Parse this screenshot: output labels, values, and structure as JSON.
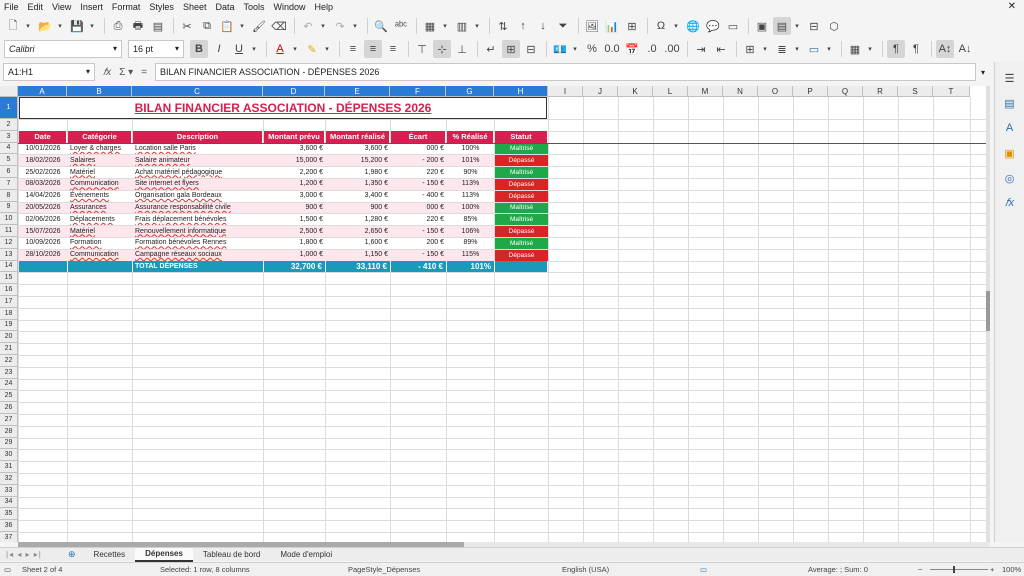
{
  "menu": [
    "File",
    "Edit",
    "View",
    "Insert",
    "Format",
    "Styles",
    "Sheet",
    "Data",
    "Tools",
    "Window",
    "Help"
  ],
  "font": {
    "name": "Calibri",
    "size": "16 pt"
  },
  "formula": {
    "namebox": "A1:H1",
    "content": "BILAN FINANCIER ASSOCIATION - DÉPENSES 2026"
  },
  "columns": [
    "A",
    "B",
    "C",
    "D",
    "E",
    "F",
    "G",
    "H",
    "I",
    "J",
    "K",
    "L",
    "M",
    "N",
    "O",
    "P",
    "Q",
    "R",
    "S",
    "T"
  ],
  "title": "BILAN FINANCIER ASSOCIATION - DÉPENSES 2026",
  "headers": [
    "Date",
    "Catégorie",
    "Description",
    "Montant prévu",
    "Montant réalisé",
    "Écart",
    "% Réalisé",
    "Statut"
  ],
  "rows": [
    {
      "date": "10/01/2026",
      "cat": "Loyer & charges",
      "desc": "Location salle Paris",
      "prevu": "3,600 €",
      "reel": "3,600 €",
      "ecart": "000 €",
      "pct": "100%",
      "statut": "Maîtrisé",
      "ok": true
    },
    {
      "date": "18/02/2026",
      "cat": "Salaires",
      "desc": "Salaire animateur",
      "prevu": "15,000 €",
      "reel": "15,200 €",
      "ecart": "- 200 €",
      "pct": "101%",
      "statut": "Dépassé",
      "ok": false
    },
    {
      "date": "25/02/2026",
      "cat": "Matériel",
      "desc": "Achat matériel pédagogique",
      "prevu": "2,200 €",
      "reel": "1,980 €",
      "ecart": "220 €",
      "pct": "90%",
      "statut": "Maîtrisé",
      "ok": true
    },
    {
      "date": "08/03/2026",
      "cat": "Communication",
      "desc": "Site internet et flyers",
      "prevu": "1,200 €",
      "reel": "1,350 €",
      "ecart": "- 150 €",
      "pct": "113%",
      "statut": "Dépassé",
      "ok": false
    },
    {
      "date": "14/04/2026",
      "cat": "Événements",
      "desc": "Organisation gala Bordeaux",
      "prevu": "3,000 €",
      "reel": "3,400 €",
      "ecart": "- 400 €",
      "pct": "113%",
      "statut": "Dépassé",
      "ok": false
    },
    {
      "date": "20/05/2026",
      "cat": "Assurances",
      "desc": "Assurance responsabilité civile",
      "prevu": "900 €",
      "reel": "900 €",
      "ecart": "000 €",
      "pct": "100%",
      "statut": "Maîtrisé",
      "ok": true
    },
    {
      "date": "02/06/2026",
      "cat": "Déplacements",
      "desc": "Frais déplacement bénévoles",
      "prevu": "1,500 €",
      "reel": "1,280 €",
      "ecart": "220 €",
      "pct": "85%",
      "statut": "Maîtrisé",
      "ok": true
    },
    {
      "date": "15/07/2026",
      "cat": "Matériel",
      "desc": "Renouvellement informatique",
      "prevu": "2,500 €",
      "reel": "2,650 €",
      "ecart": "- 150 €",
      "pct": "106%",
      "statut": "Dépassé",
      "ok": false
    },
    {
      "date": "10/09/2026",
      "cat": "Formation",
      "desc": "Formation bénévoles Rennes",
      "prevu": "1,800 €",
      "reel": "1,600 €",
      "ecart": "200 €",
      "pct": "89%",
      "statut": "Maîtrisé",
      "ok": true
    },
    {
      "date": "28/10/2026",
      "cat": "Communication",
      "desc": "Campagne réseaux sociaux",
      "prevu": "1,000 €",
      "reel": "1,150 €",
      "ecart": "- 150 €",
      "pct": "115%",
      "statut": "Dépassé",
      "ok": false
    }
  ],
  "total": {
    "label": "TOTAL DÉPENSES",
    "prevu": "32,700 €",
    "reel": "33,110 €",
    "ecart": "- 410 €",
    "pct": "101%"
  },
  "tabs": [
    "Recettes",
    "Dépenses",
    "Tableau de bord",
    "Mode d'emploi"
  ],
  "active_tab": 1,
  "status": {
    "sheet": "Sheet 2 of 4",
    "selection": "Selected: 1 row, 8 columns",
    "pagestyle": "PageStyle_Dépenses",
    "lang": "English (USA)",
    "stats": "Average: ; Sum: 0",
    "zoom": "100%"
  },
  "colors": {
    "header": "#d81f4f",
    "total": "#1a9ab8",
    "ok": "#1fa84a",
    "over": "#d82424",
    "selection": "#2a7bd6"
  }
}
